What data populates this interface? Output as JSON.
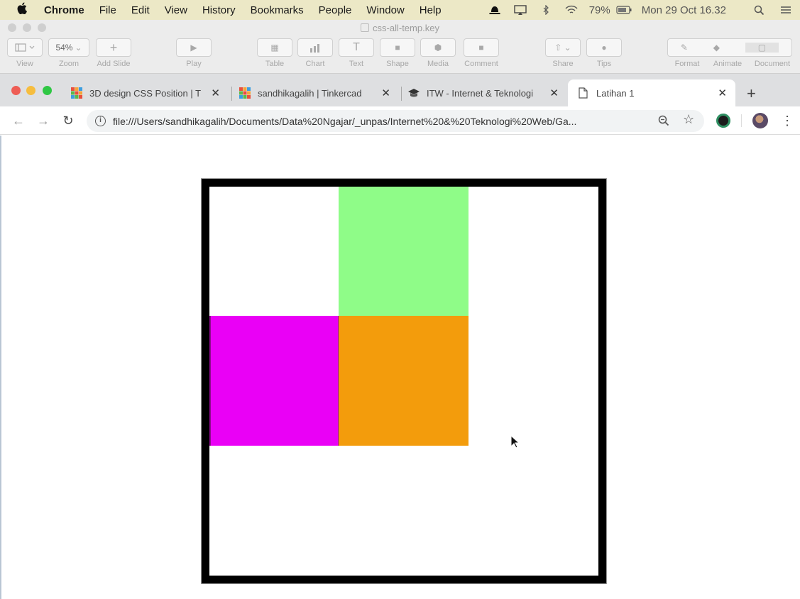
{
  "menubar": {
    "app_name": "Chrome",
    "items": [
      "File",
      "Edit",
      "View",
      "History",
      "Bookmarks",
      "People",
      "Window",
      "Help"
    ],
    "battery": "79%",
    "clock": "Mon 29 Oct  16.32"
  },
  "keynote": {
    "title": "css-all-temp.key",
    "zoom_value": "54%",
    "labels": [
      "View",
      "Zoom",
      "Add Slide",
      "Play",
      "Table",
      "Chart",
      "Text",
      "Shape",
      "Media",
      "Comment",
      "Share",
      "Tips",
      "Format",
      "Animate",
      "Document"
    ]
  },
  "tabs": [
    {
      "label": "3D design CSS Position | T"
    },
    {
      "label": "sandhikagalih | Tinkercad"
    },
    {
      "label": "ITW - Internet & Teknologi"
    },
    {
      "label": "Latihan 1"
    }
  ],
  "address_bar": {
    "url": "file:///Users/sandhikagalih/Documents/Data%20Ngajar/_unpas/Internet%20&%20Teknologi%20Web/Ga..."
  },
  "boxes": {
    "green": "#8ffc88",
    "magenta": "#ea00f6",
    "orange": "#f39c0c"
  },
  "colors": {
    "container_border": "#000000",
    "menubar_bg": "#ece8c6"
  }
}
